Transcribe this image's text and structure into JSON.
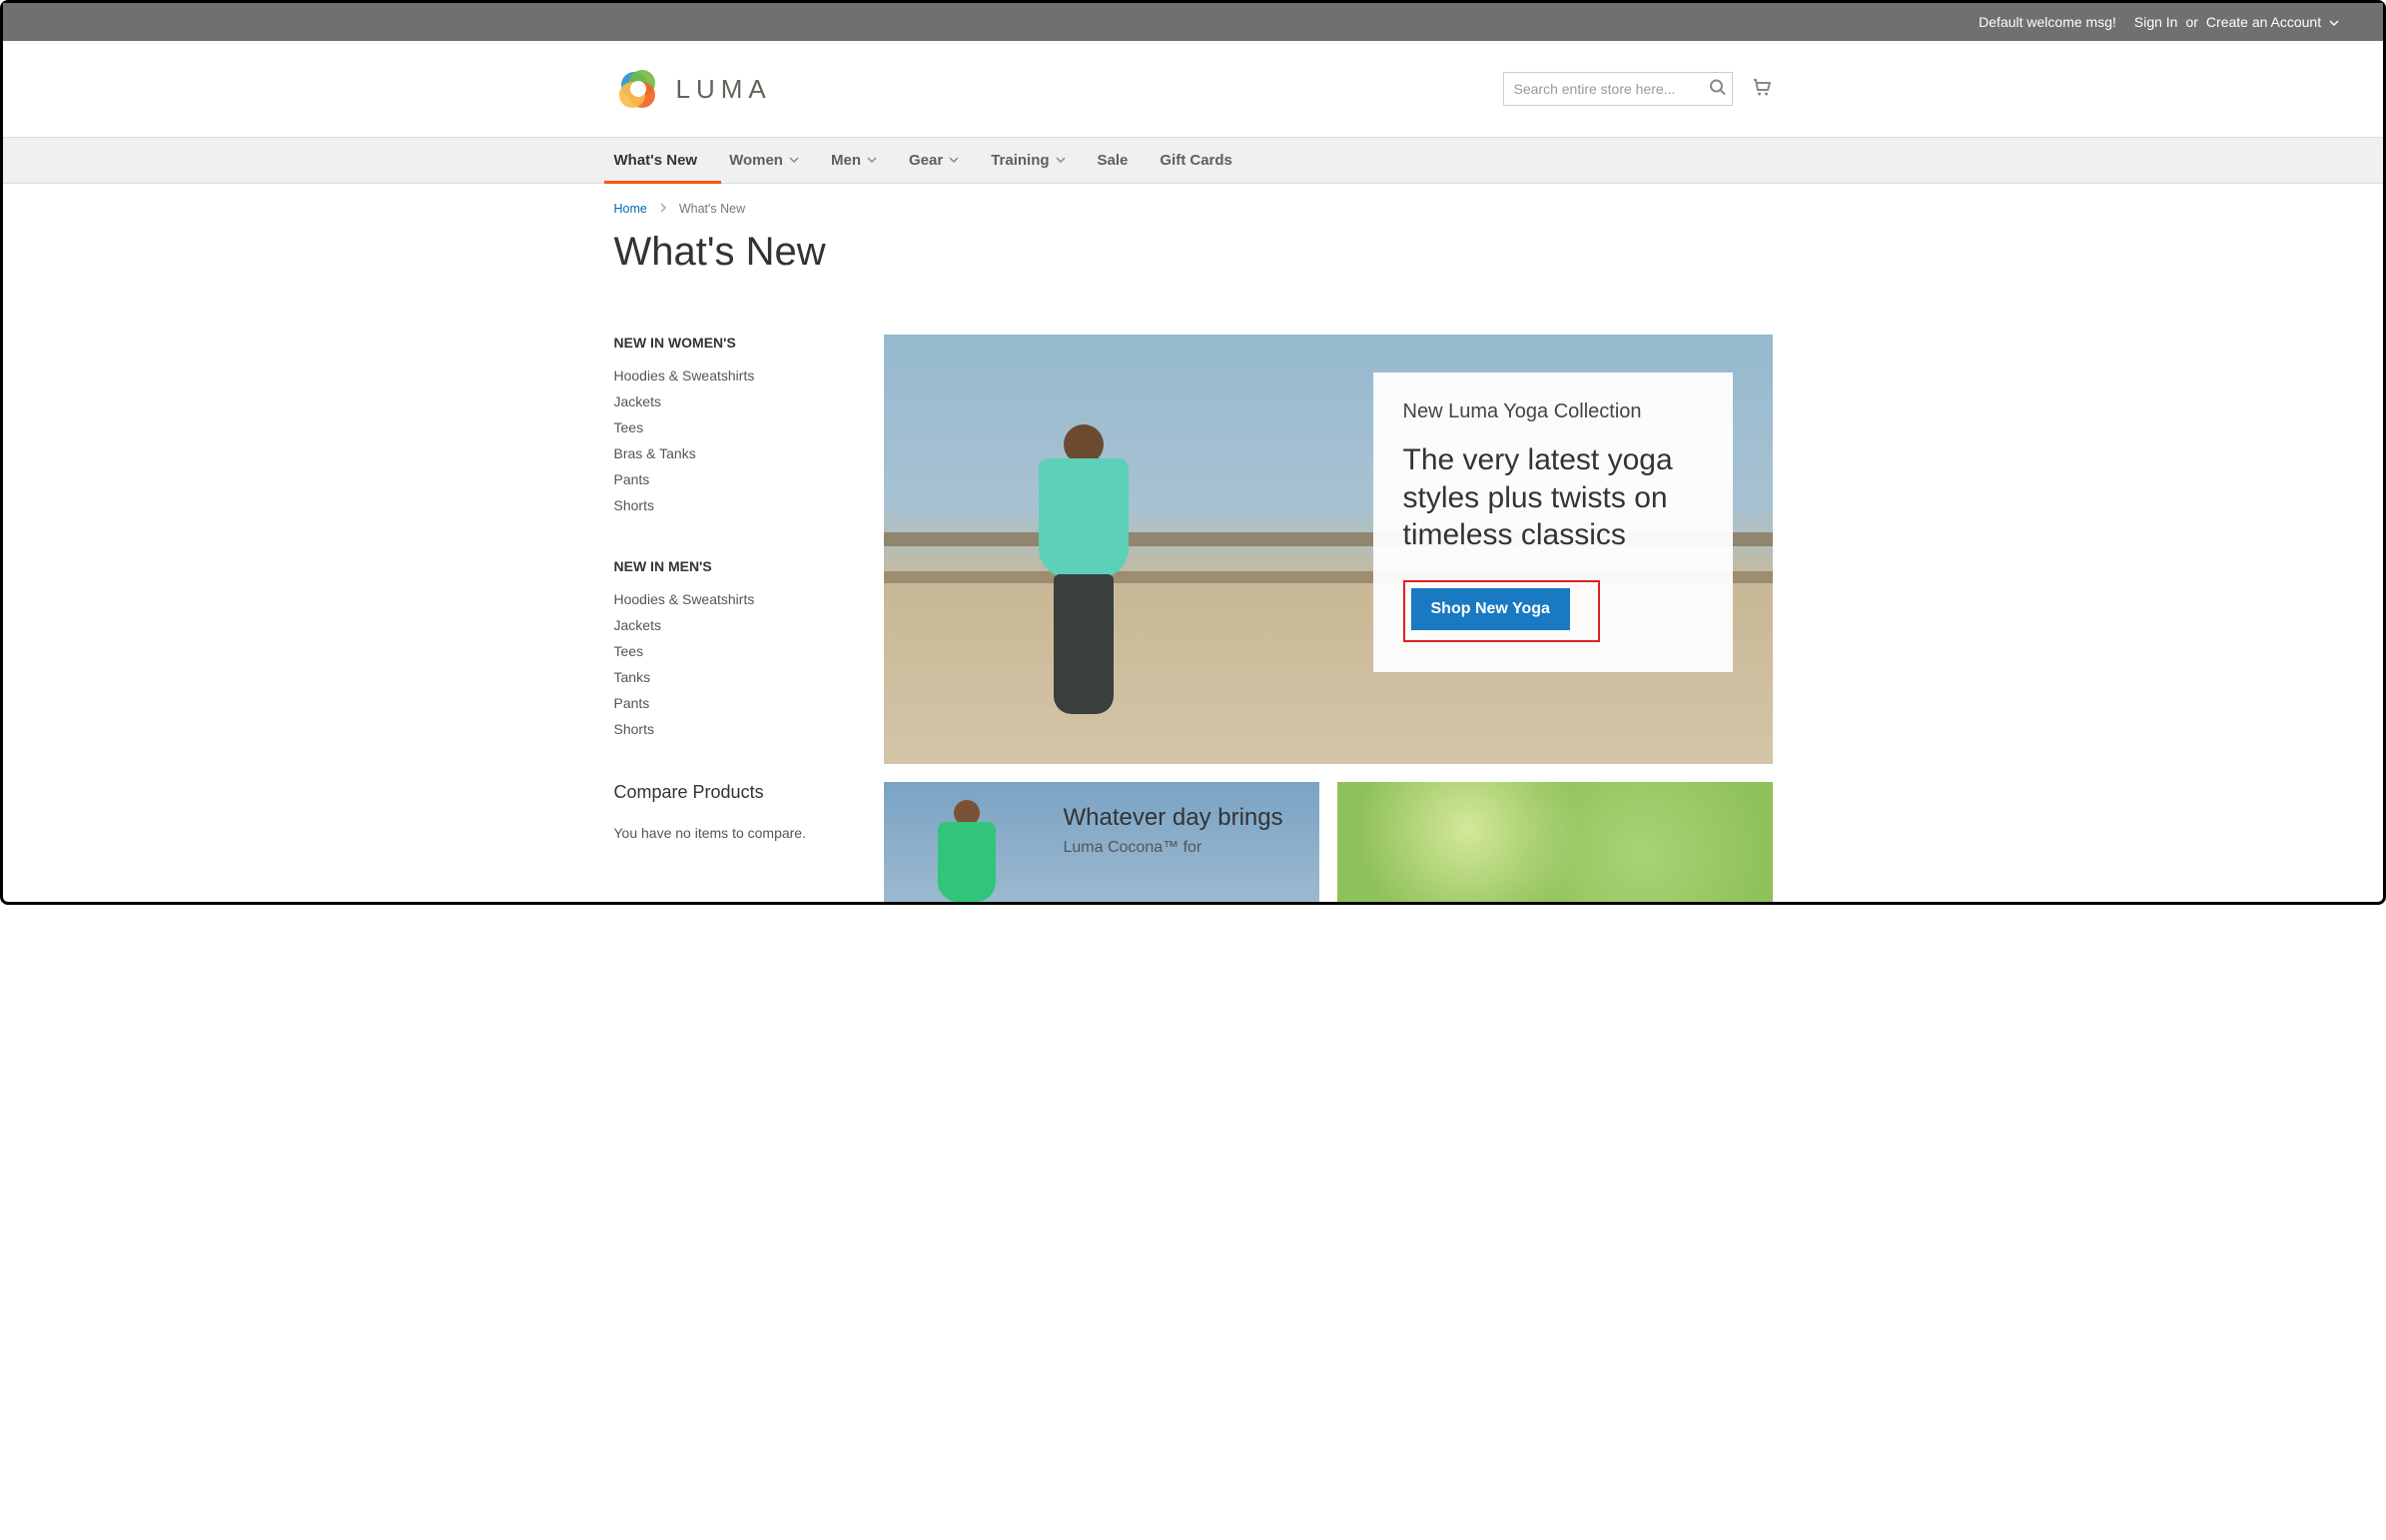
{
  "topbar": {
    "welcome": "Default welcome msg!",
    "sign_in": "Sign In",
    "or": "or",
    "create_account": "Create an Account"
  },
  "header": {
    "logo_text": "LUMA",
    "search_placeholder": "Search entire store here..."
  },
  "nav": {
    "items": [
      {
        "label": "What's New",
        "has_dropdown": false,
        "active": true
      },
      {
        "label": "Women",
        "has_dropdown": true
      },
      {
        "label": "Men",
        "has_dropdown": true
      },
      {
        "label": "Gear",
        "has_dropdown": true
      },
      {
        "label": "Training",
        "has_dropdown": true
      },
      {
        "label": "Sale",
        "has_dropdown": false
      },
      {
        "label": "Gift Cards",
        "has_dropdown": false
      }
    ]
  },
  "breadcrumb": {
    "home": "Home",
    "current": "What's New"
  },
  "page": {
    "title": "What's New"
  },
  "sidebar": {
    "blocks": [
      {
        "heading": "NEW IN WOMEN'S",
        "items": [
          "Hoodies & Sweatshirts",
          "Jackets",
          "Tees",
          "Bras & Tanks",
          "Pants",
          "Shorts"
        ]
      },
      {
        "heading": "NEW IN MEN'S",
        "items": [
          "Hoodies & Sweatshirts",
          "Jackets",
          "Tees",
          "Tanks",
          "Pants",
          "Shorts"
        ]
      }
    ],
    "compare": {
      "title": "Compare Products",
      "empty": "You have no items to compare."
    }
  },
  "promo": {
    "hero": {
      "info": "New Luma Yoga Collection",
      "title": "The very latest yoga styles plus twists on timeless classics",
      "button": "Shop New Yoga"
    },
    "half": [
      {
        "title": "Whatever day brings",
        "sub": "Luma Cocona™ for"
      },
      {
        "title": "",
        "sub": ""
      }
    ]
  }
}
